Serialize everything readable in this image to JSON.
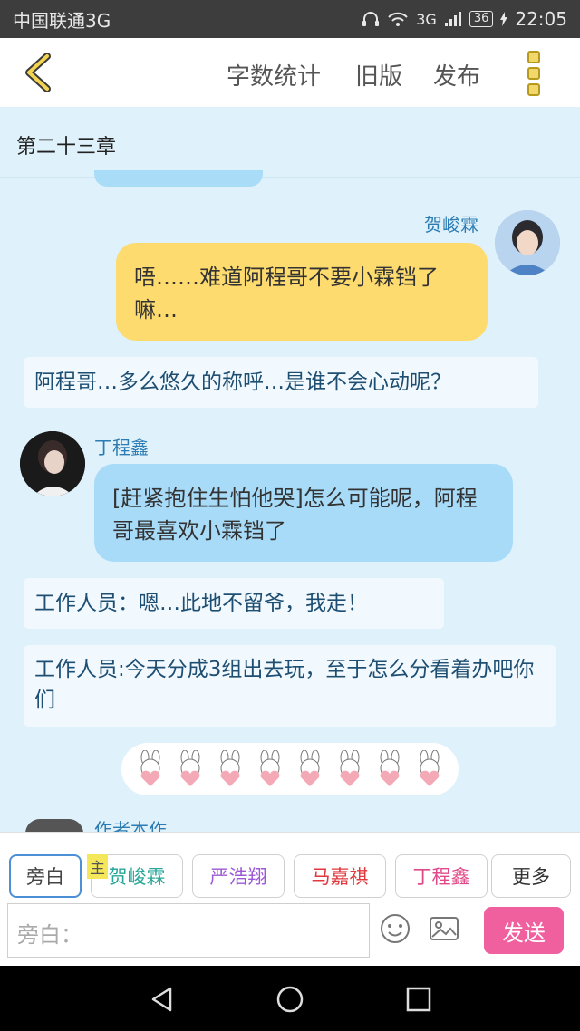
{
  "status": {
    "carrier": "中国联通3G",
    "net": "3G",
    "battery": "36",
    "time": "22:05"
  },
  "topbar": {
    "word_count": "字数统计",
    "old_version": "旧版",
    "publish": "发布"
  },
  "chapter_title": "第二十三章",
  "messages": [
    {
      "speaker": "贺峻霖",
      "text": "唔……难道阿程哥不要小霖铛了嘛…"
    },
    {
      "narration": "阿程哥…多么悠久的称呼…是谁不会心动呢？"
    },
    {
      "speaker": "丁程鑫",
      "text": "[赶紧抱住生怕他哭]怎么可能呢，阿程哥最喜欢小霖铛了"
    },
    {
      "narration": "工作人员：嗯…此地不留爷，我走！"
    },
    {
      "narration": "工作人员:今天分成3组出去玩，至于怎么分看着办吧你们"
    }
  ],
  "author_peek": "作者本作",
  "roles": [
    "旁白",
    "贺峻霖",
    "严浩翔",
    "马嘉祺",
    "丁程鑫",
    "更多"
  ],
  "role_colors": [
    "#555555",
    "#2aa79b",
    "#9b59d6",
    "#e0393e",
    "#e04a8a",
    "#333333"
  ],
  "main_badge": "主",
  "input": {
    "placeholder": "旁白："
  },
  "send_label": "发送"
}
